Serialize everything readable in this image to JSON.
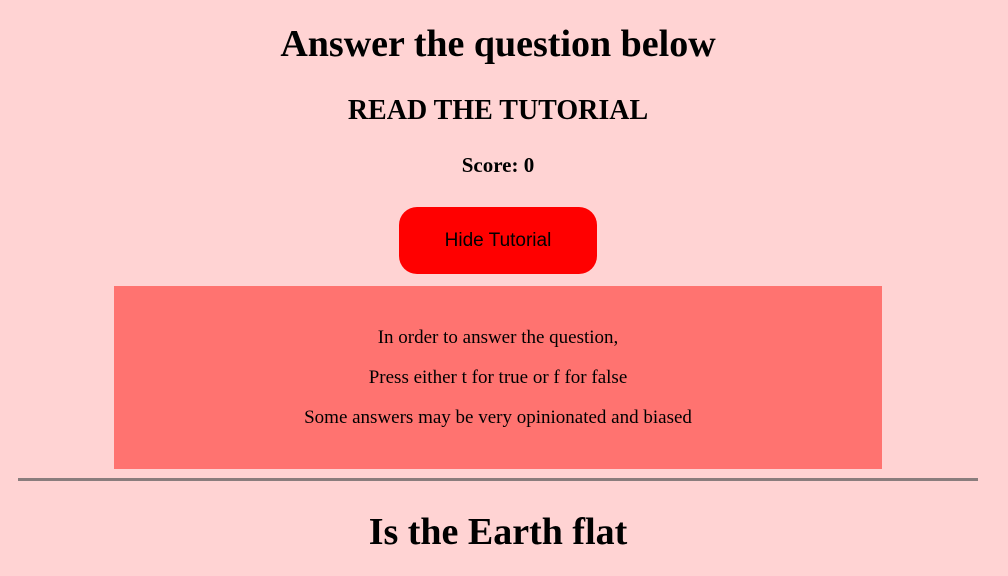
{
  "header": {
    "title": "Answer the question below",
    "subtitle": "READ THE TUTORIAL",
    "score_label": "Score:",
    "score_value": "0"
  },
  "tutorial": {
    "toggle_label": "Hide Tutorial",
    "lines": [
      "In order to answer the question,",
      "Press either t for true or f for false",
      "Some answers may be very opinionated and biased"
    ]
  },
  "quiz": {
    "question": "Is the Earth flat"
  },
  "colors": {
    "background": "#ffd3d3",
    "button": "#ff0000",
    "tutorial_panel": "#ff7370",
    "divider": "#8a7d7d"
  }
}
